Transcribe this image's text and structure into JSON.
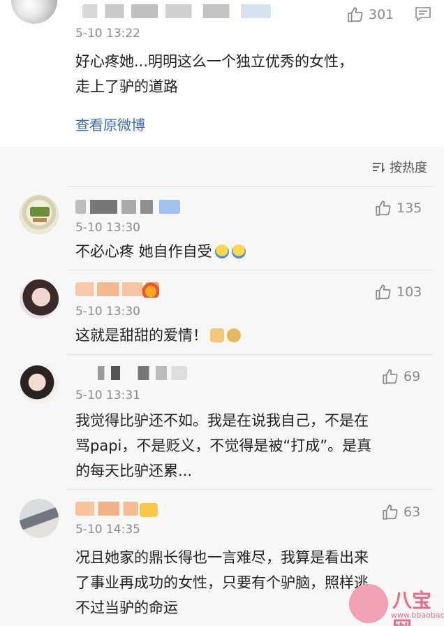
{
  "top_comment": {
    "timestamp": "5-10 13:22",
    "like_count": "301",
    "text": "好心疼她...明明这么一个独立优秀的女性，\n走上了驴的道路",
    "view_original_label": "查看原微博"
  },
  "sort": {
    "label": "按热度"
  },
  "replies": [
    {
      "timestamp": "5-10 13:30",
      "like_count": "135",
      "text": "不必心疼 她自作自受"
    },
    {
      "timestamp": "5-10 13:30",
      "like_count": "103",
      "text": "这就是甜甜的爱情！"
    },
    {
      "timestamp": "5-10 13:31",
      "like_count": "69",
      "text": "我觉得比驴还不如。我是在说我自己，不是在\n骂papi，不是贬义，不觉得是被“打成”。是真\n的每天比驴还累..."
    },
    {
      "timestamp": "5-10 14:35",
      "like_count": "63",
      "text": "况且她家的鼎长得也一言难尽，我算是看出来\n了事业再成功的女性，只要有个驴脑，照样逃\n不过当驴的命运"
    }
  ],
  "watermark": {
    "title": "八宝网",
    "sub": "www.bbaobao.com"
  },
  "colors": {
    "link": "#3b6ea8",
    "meta": "#8a8a8a",
    "list_bg": "#f7f7f7",
    "watermark": "#e86d8a"
  }
}
